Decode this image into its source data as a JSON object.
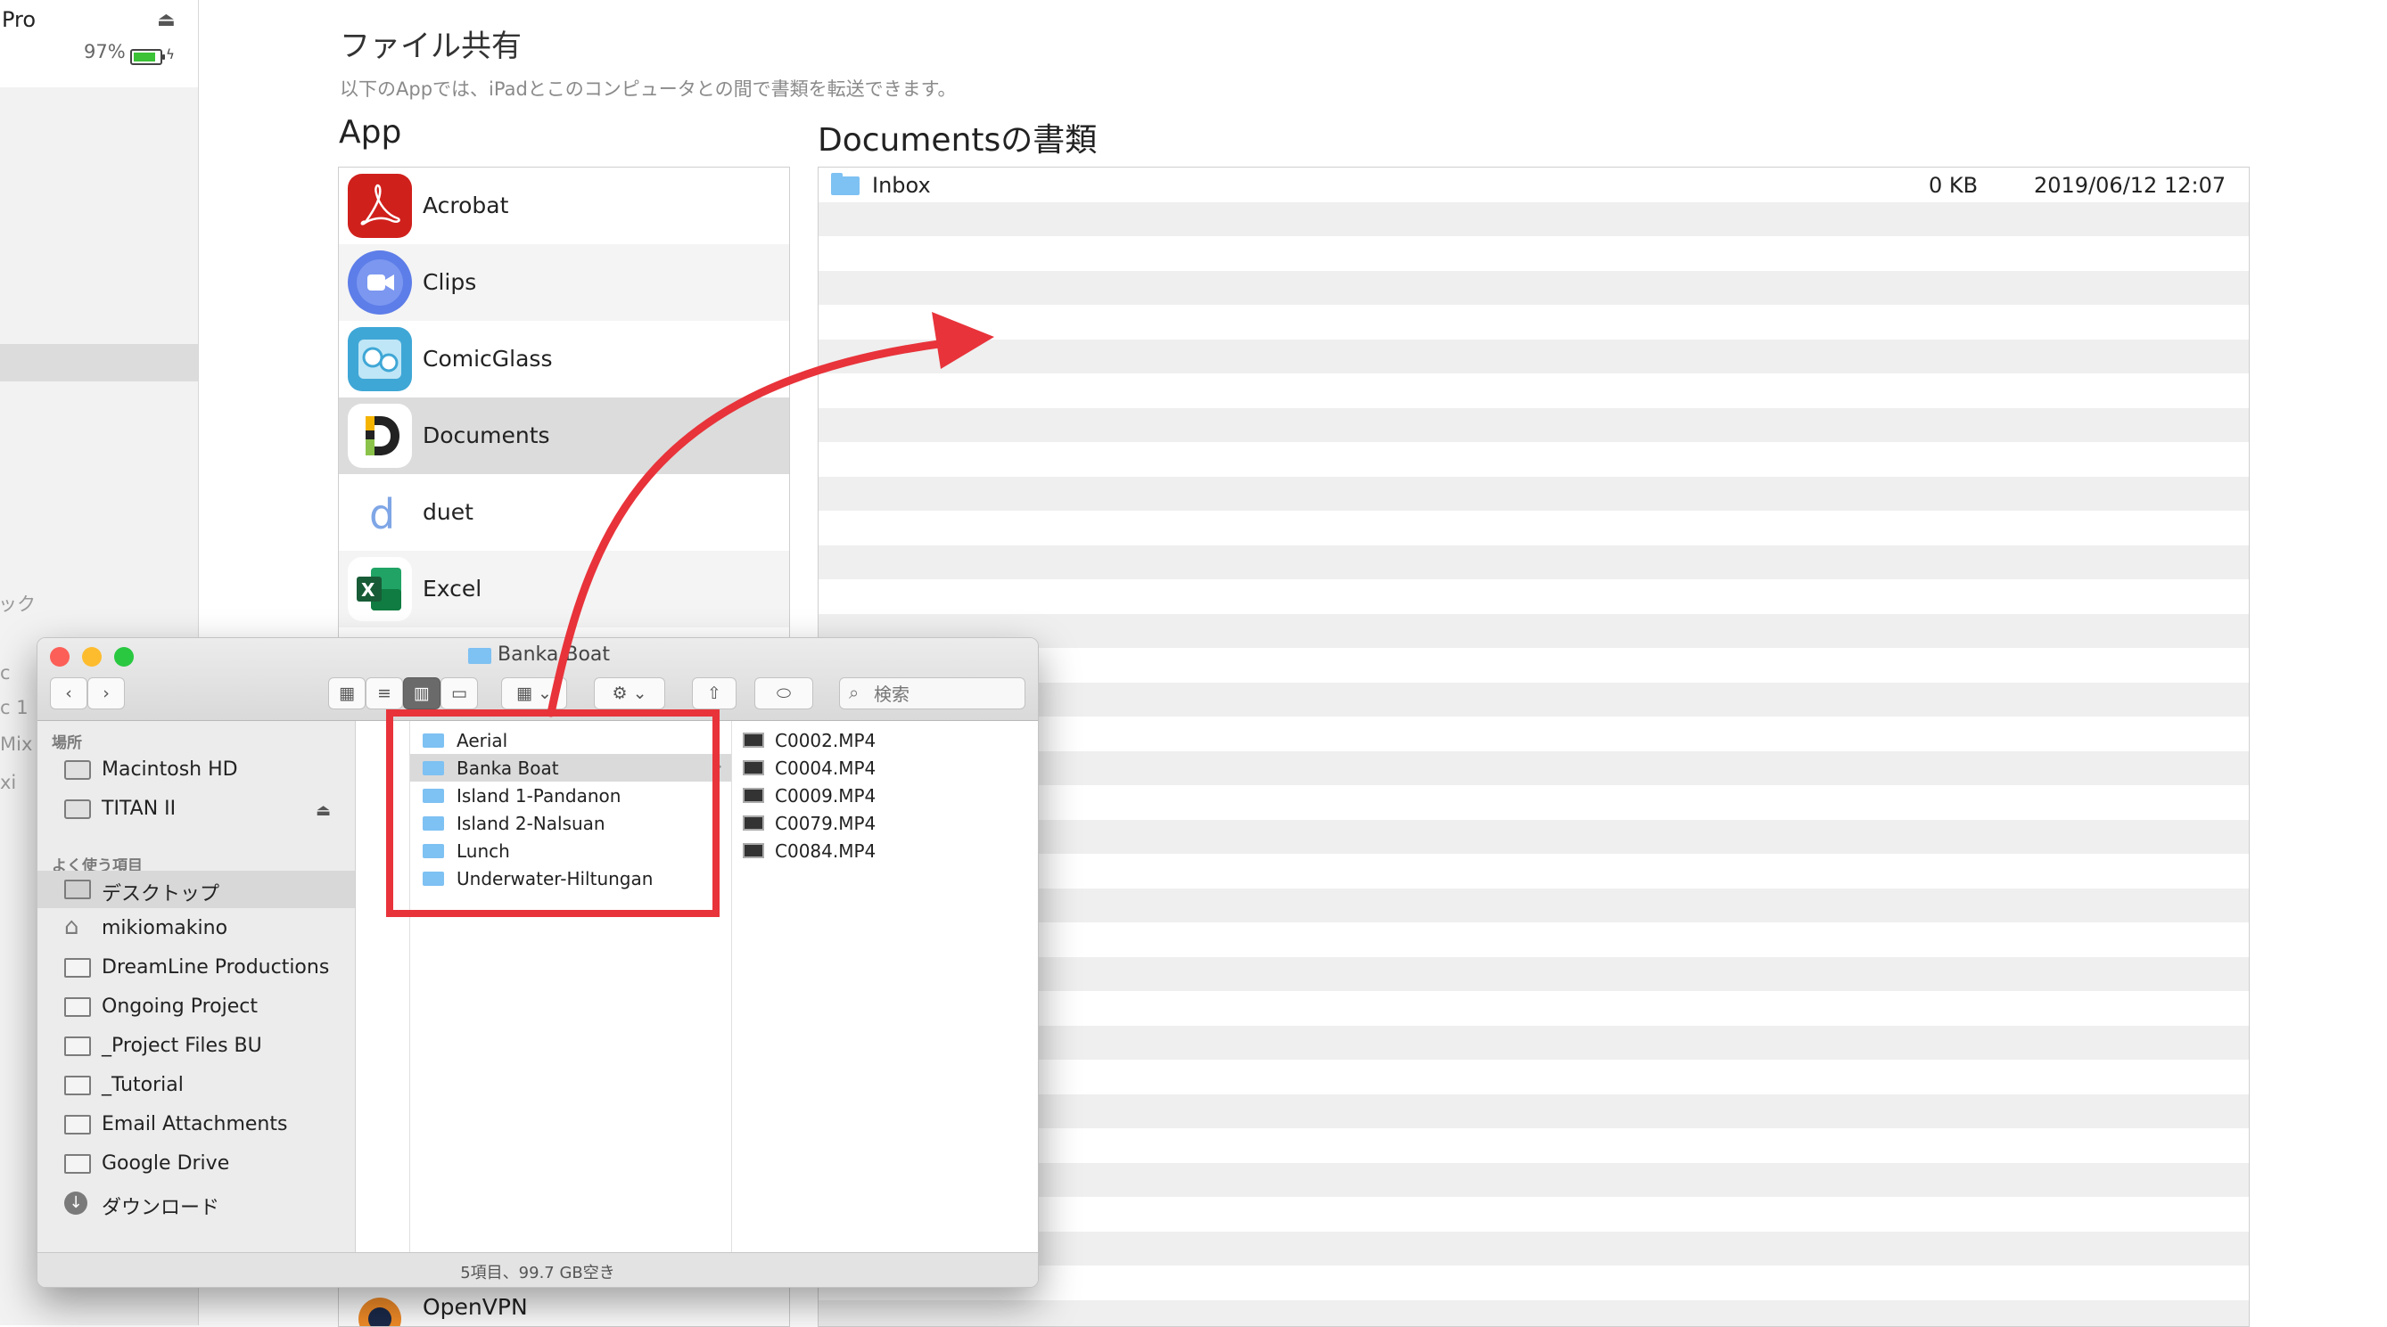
{
  "device_sidebar": {
    "device_name": "Pro",
    "battery_percent": "97%",
    "battery_level": 0.97,
    "fragments": [
      "ック",
      "c",
      "c 1",
      "Mix",
      "xi"
    ]
  },
  "file_sharing": {
    "title": "ファイル共有",
    "subtitle": "以下のAppでは、iPadとこのコンピュータとの間で書類を転送できます。",
    "apps_header": "App",
    "docs_header": "Documentsの書類",
    "apps": [
      {
        "name": "Acrobat",
        "icon": "acrobat-icon",
        "color": "#d0201c"
      },
      {
        "name": "Clips",
        "icon": "clips-icon",
        "color": "#5d7de8"
      },
      {
        "name": "ComicGlass",
        "icon": "comicglass-icon",
        "color": "#3fa7d6"
      },
      {
        "name": "Documents",
        "icon": "documents-icon",
        "color": "#ffffff"
      },
      {
        "name": "duet",
        "icon": "duet-icon",
        "color": "#ffffff"
      },
      {
        "name": "Excel",
        "icon": "excel-icon",
        "color": "#1e7145"
      },
      {
        "name": "OpenVPN",
        "icon": "openvpn-icon",
        "color": "#f28c28"
      }
    ],
    "documents": [
      {
        "name": "Inbox",
        "size": "0 KB",
        "date": "2019/06/12 12:07"
      }
    ]
  },
  "finder": {
    "title": "Banka Boat",
    "search_placeholder": "検索",
    "sidebar": {
      "places_header": "場所",
      "places": [
        {
          "label": "Macintosh HD",
          "icon": "hard-drive-icon"
        },
        {
          "label": "TITAN II",
          "icon": "external-drive-icon",
          "eject": "⏏"
        }
      ],
      "favorites_header": "よく使う項目",
      "favorites": [
        {
          "label": "デスクトップ",
          "icon": "desktop-icon"
        },
        {
          "label": "mikiomakino",
          "icon": "home-icon"
        },
        {
          "label": "DreamLine Productions",
          "icon": "folder-icon"
        },
        {
          "label": "Ongoing Project",
          "icon": "folder-icon"
        },
        {
          "label": "_Project Files BU",
          "icon": "folder-icon"
        },
        {
          "label": "_Tutorial",
          "icon": "folder-icon"
        },
        {
          "label": "Email Attachments",
          "icon": "folder-icon"
        },
        {
          "label": "Google Drive",
          "icon": "folder-icon"
        },
        {
          "label": "ダウンロード",
          "icon": "download-icon"
        }
      ]
    },
    "folders": [
      "Aerial",
      "Banka Boat",
      "Island 1-Pandanon",
      "Island 2-Nalsuan",
      "Lunch",
      "Underwater-Hiltungan"
    ],
    "selected_folder": "Banka Boat",
    "files": [
      "C0002.MP4",
      "C0004.MP4",
      "C0009.MP4",
      "C0079.MP4",
      "C0084.MP4"
    ],
    "status": "5項目、99.7 GB空き",
    "colors": {
      "close": "#fc5f57",
      "minimize": "#fdbc2e",
      "zoom": "#29c840"
    }
  },
  "annotation": {
    "color": "#e8333a"
  }
}
